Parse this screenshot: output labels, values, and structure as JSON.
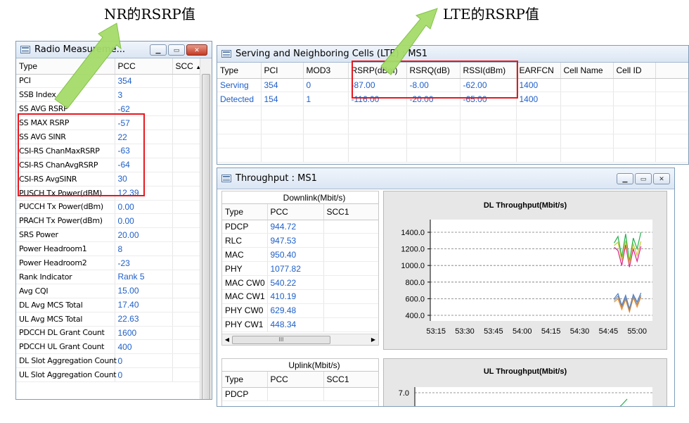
{
  "annotations": {
    "nr_label": "NR的RSRP值",
    "lte_label": "LTE的RSRP值"
  },
  "radio_window": {
    "title": "Radio Measureme...",
    "columns": [
      "Type",
      "PCC",
      "SCC"
    ],
    "rows": [
      {
        "type": "PCI",
        "pcc": "354"
      },
      {
        "type": "SSB Index",
        "pcc": "3"
      },
      {
        "type": "SS AVG RSRP",
        "pcc": "-62"
      },
      {
        "type": "SS MAX RSRP",
        "pcc": "-57"
      },
      {
        "type": "SS AVG SINR",
        "pcc": "22"
      },
      {
        "type": "CSI-RS ChanMaxRSRP",
        "pcc": "-63"
      },
      {
        "type": "CSI-RS ChanAvgRSRP",
        "pcc": "-64"
      },
      {
        "type": "CSI-RS AvgSINR",
        "pcc": "30"
      },
      {
        "type": "PUSCH Tx Power(dBM)",
        "pcc": "12.39"
      },
      {
        "type": "PUCCH Tx Power(dBm)",
        "pcc": "0.00"
      },
      {
        "type": "PRACH Tx Power(dBm)",
        "pcc": "0.00"
      },
      {
        "type": "SRS Power",
        "pcc": "20.00"
      },
      {
        "type": "Power Headroom1",
        "pcc": "8"
      },
      {
        "type": "Power Headroom2",
        "pcc": "-23"
      },
      {
        "type": "Rank Indicator",
        "pcc": "Rank 5"
      },
      {
        "type": "Avg CQI",
        "pcc": "15.00"
      },
      {
        "type": "DL Avg MCS Total",
        "pcc": "17.40"
      },
      {
        "type": "UL Avg MCS Total",
        "pcc": "22.63"
      },
      {
        "type": "PDCCH DL Grant Count",
        "pcc": "1600"
      },
      {
        "type": "PDCCH UL Grant Count",
        "pcc": "400"
      },
      {
        "type": "DL Slot Aggregation Count",
        "pcc": "0"
      },
      {
        "type": "UL Slot Aggregation Count",
        "pcc": "0"
      }
    ]
  },
  "serving_window": {
    "title": "Serving and Neighboring Cells (LTE) : MS1",
    "columns": [
      "Type",
      "PCI",
      "MOD3",
      "RSRP(dBm)",
      "RSRQ(dB)",
      "RSSI(dBm)",
      "EARFCN",
      "Cell Name",
      "Cell ID"
    ],
    "rows": [
      [
        "Serving",
        "354",
        "0",
        "-87.00",
        "-8.00",
        "-62.00",
        "1400",
        "",
        ""
      ],
      [
        "Detected",
        "154",
        "1",
        "-116.00",
        "-20.00",
        "-65.00",
        "1400",
        "",
        ""
      ]
    ]
  },
  "throughput_window": {
    "title": "Throughput : MS1",
    "downlink": {
      "header": "Downlink(Mbit/s)",
      "columns": [
        "Type",
        "PCC",
        "SCC1"
      ],
      "rows": [
        {
          "type": "PDCP",
          "pcc": "944.72"
        },
        {
          "type": "RLC",
          "pcc": "947.53"
        },
        {
          "type": "MAC",
          "pcc": "950.40"
        },
        {
          "type": "PHY",
          "pcc": "1077.82"
        },
        {
          "type": "MAC CW0",
          "pcc": "540.22"
        },
        {
          "type": "MAC CW1",
          "pcc": "410.19"
        },
        {
          "type": "PHY CW0",
          "pcc": "629.48"
        },
        {
          "type": "PHY CW1",
          "pcc": "448.34"
        }
      ]
    },
    "uplink": {
      "header": "Uplink(Mbit/s)",
      "columns": [
        "Type",
        "PCC",
        "SCC1"
      ],
      "rows": [
        {
          "type": "PDCP",
          "pcc": ""
        }
      ]
    },
    "hscroll_label": "III"
  },
  "colors": {
    "red_highlight": "#e8171e",
    "value_blue": "#1f5fc8",
    "arrow_green": "#a6dc6a"
  },
  "chart_data": [
    {
      "type": "line",
      "title": "DL Throughput(Mbit/s)",
      "y_ticks": [
        "1400.0",
        "1200.0",
        "1000.0",
        "800.0",
        "600.0",
        "400.0"
      ],
      "ylim": [
        400,
        1400
      ],
      "x_ticks": [
        "53:15",
        "53:30",
        "53:45",
        "54:00",
        "54:15",
        "54:30",
        "54:45",
        "55:00"
      ],
      "grid": true,
      "series": [
        {
          "color": "#22b14c",
          "x": [
            "54:48",
            "54:50",
            "54:52",
            "54:54",
            "54:56",
            "54:58",
            "55:00",
            "55:02"
          ],
          "values": [
            1270,
            1350,
            1100,
            1380,
            1050,
            1330,
            1200,
            1400
          ]
        },
        {
          "color": "#e0218a",
          "x": [
            "54:48",
            "54:50",
            "54:52",
            "54:54",
            "54:56",
            "54:58",
            "55:00",
            "55:02"
          ],
          "values": [
            1220,
            1180,
            1000,
            1250,
            980,
            1200,
            1050,
            1230
          ]
        },
        {
          "color": "#c8c832",
          "x": [
            "54:48",
            "54:50",
            "54:52",
            "54:54",
            "54:56",
            "54:58",
            "55:00",
            "55:02"
          ],
          "values": [
            1240,
            1280,
            1060,
            1300,
            1020,
            1260,
            1120,
            1290
          ]
        },
        {
          "color": "#4a7fd4",
          "x": [
            "54:48",
            "54:50",
            "54:52",
            "54:54",
            "54:56",
            "54:58",
            "55:00",
            "55:02"
          ],
          "values": [
            600,
            660,
            520,
            640,
            480,
            650,
            560,
            670
          ]
        },
        {
          "color": "#f08c28",
          "x": [
            "54:48",
            "54:50",
            "54:52",
            "54:54",
            "54:56",
            "54:58",
            "55:00",
            "55:02"
          ],
          "values": [
            560,
            600,
            470,
            590,
            440,
            610,
            500,
            620
          ]
        },
        {
          "color": "#8a8a8a",
          "x": [
            "54:48",
            "54:50",
            "54:52",
            "54:54",
            "54:56",
            "54:58",
            "55:00",
            "55:02"
          ],
          "values": [
            580,
            630,
            500,
            610,
            460,
            630,
            530,
            640
          ]
        }
      ]
    },
    {
      "type": "line",
      "title": "UL Throughput(Mbit/s)",
      "y_ticks": [
        "7.0"
      ],
      "grid": true,
      "series": [
        {
          "color": "#22b14c",
          "x": [
            "54:58",
            "55:00",
            "55:02"
          ],
          "values": [
            5.5,
            6.0,
            6.6
          ]
        }
      ]
    }
  ]
}
